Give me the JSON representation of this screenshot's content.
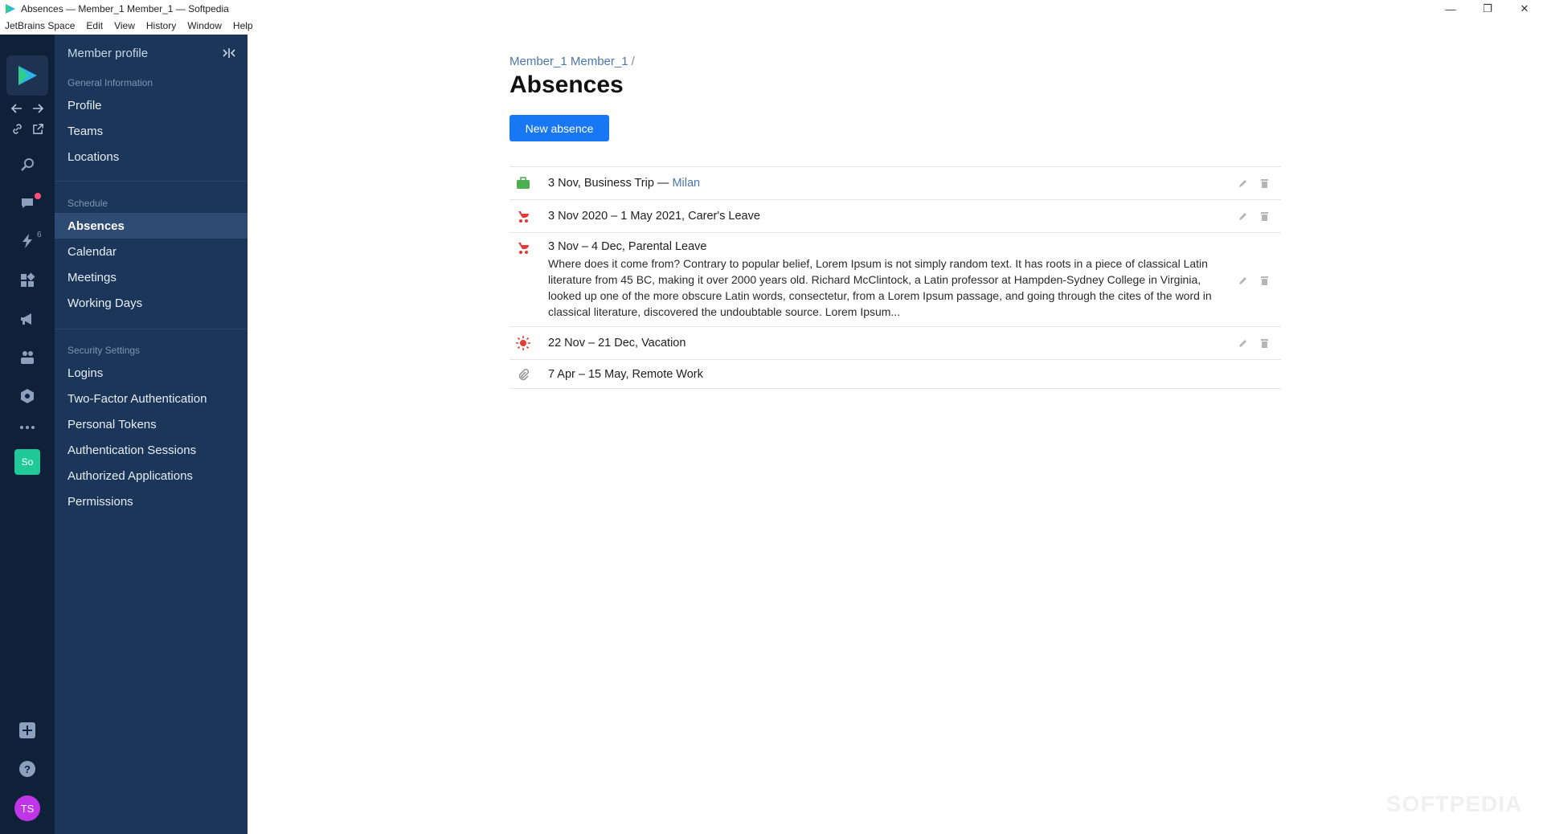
{
  "window": {
    "title": "Absences — Member_1 Member_1 — Softpedia",
    "controls": {
      "minimize": "—",
      "restore": "❐",
      "close": "✕"
    }
  },
  "menubar": [
    "JetBrains Space",
    "Edit",
    "View",
    "History",
    "Window",
    "Help"
  ],
  "rail": {
    "icons": [
      "space-logo-icon",
      "back-arrow-icon",
      "forward-arrow-icon",
      "link-icon",
      "open-external-icon",
      "search-icon",
      "chat-icon",
      "lightning-icon",
      "apps-icon",
      "megaphone-icon",
      "team-icon",
      "hexagon-settings-icon",
      "more-icon",
      "add-icon",
      "help-icon"
    ],
    "lightning_count": "6",
    "org_avatar": "So",
    "user_avatar": "TS",
    "colors": {
      "bg": "#0f2138",
      "org_avatar_bg": "#20c997",
      "user_avatar_bg": "#c035e8",
      "notification": "#ff4d7a"
    }
  },
  "sidebar": {
    "title": "Member profile",
    "sections": [
      {
        "label": "General Information",
        "items": [
          "Profile",
          "Teams",
          "Locations"
        ]
      },
      {
        "label": "Schedule",
        "items": [
          "Absences",
          "Calendar",
          "Meetings",
          "Working Days"
        ]
      },
      {
        "label": "Security Settings",
        "items": [
          "Logins",
          "Two-Factor Authentication",
          "Personal Tokens",
          "Authentication Sessions",
          "Authorized Applications",
          "Permissions"
        ]
      }
    ],
    "active_item": "Absences"
  },
  "main": {
    "breadcrumb": "Member_1 Member_1",
    "breadcrumb_sep": "/",
    "title": "Absences",
    "new_button": "New absence",
    "absences": [
      {
        "icon": "briefcase-icon",
        "title": "3 Nov, Business Trip — ",
        "location": "Milan",
        "editable": true
      },
      {
        "icon": "stroller-icon",
        "title": "3 Nov 2020 – 1 May 2021, Carer's Leave",
        "location": "",
        "editable": true
      },
      {
        "icon": "stroller-icon",
        "title": "3 Nov – 4 Dec, Parental Leave",
        "location": "",
        "description": "Where does it come from? Contrary to popular belief, Lorem Ipsum is not simply random text. It has roots in a piece of classical Latin literature from 45 BC, making it over 2000 years old. Richard McClintock, a Latin professor at Hampden-Sydney College in Virginia, looked up one of the more obscure Latin words, consectetur, from a Lorem Ipsum passage, and going through the cites of the word in classical literature, discovered the undoubtable source. Lorem Ipsum...",
        "editable": true
      },
      {
        "icon": "sun-icon",
        "title": "22 Nov – 21 Dec, Vacation",
        "location": "",
        "editable": true
      },
      {
        "icon": "paperclip-icon",
        "title": "7 Apr – 15 May, Remote Work",
        "location": "",
        "editable": false
      }
    ],
    "colors": {
      "accent": "#1877f2",
      "link": "#4a76b0",
      "briefcase": "#4caf50",
      "leave": "#e53935"
    }
  },
  "watermark": "SOFTPEDIA"
}
